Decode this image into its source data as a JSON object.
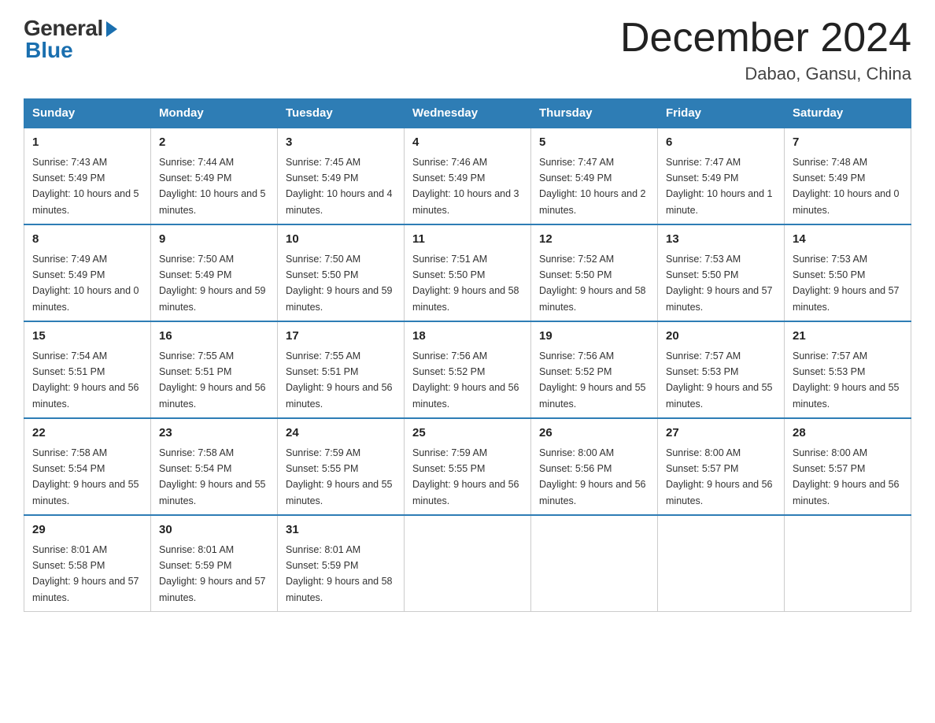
{
  "logo": {
    "general": "General",
    "blue": "Blue"
  },
  "title": "December 2024",
  "location": "Dabao, Gansu, China",
  "days_of_week": [
    "Sunday",
    "Monday",
    "Tuesday",
    "Wednesday",
    "Thursday",
    "Friday",
    "Saturday"
  ],
  "weeks": [
    [
      {
        "day": "1",
        "sunrise": "7:43 AM",
        "sunset": "5:49 PM",
        "daylight": "10 hours and 5 minutes."
      },
      {
        "day": "2",
        "sunrise": "7:44 AM",
        "sunset": "5:49 PM",
        "daylight": "10 hours and 5 minutes."
      },
      {
        "day": "3",
        "sunrise": "7:45 AM",
        "sunset": "5:49 PM",
        "daylight": "10 hours and 4 minutes."
      },
      {
        "day": "4",
        "sunrise": "7:46 AM",
        "sunset": "5:49 PM",
        "daylight": "10 hours and 3 minutes."
      },
      {
        "day": "5",
        "sunrise": "7:47 AM",
        "sunset": "5:49 PM",
        "daylight": "10 hours and 2 minutes."
      },
      {
        "day": "6",
        "sunrise": "7:47 AM",
        "sunset": "5:49 PM",
        "daylight": "10 hours and 1 minute."
      },
      {
        "day": "7",
        "sunrise": "7:48 AM",
        "sunset": "5:49 PM",
        "daylight": "10 hours and 0 minutes."
      }
    ],
    [
      {
        "day": "8",
        "sunrise": "7:49 AM",
        "sunset": "5:49 PM",
        "daylight": "10 hours and 0 minutes."
      },
      {
        "day": "9",
        "sunrise": "7:50 AM",
        "sunset": "5:49 PM",
        "daylight": "9 hours and 59 minutes."
      },
      {
        "day": "10",
        "sunrise": "7:50 AM",
        "sunset": "5:50 PM",
        "daylight": "9 hours and 59 minutes."
      },
      {
        "day": "11",
        "sunrise": "7:51 AM",
        "sunset": "5:50 PM",
        "daylight": "9 hours and 58 minutes."
      },
      {
        "day": "12",
        "sunrise": "7:52 AM",
        "sunset": "5:50 PM",
        "daylight": "9 hours and 58 minutes."
      },
      {
        "day": "13",
        "sunrise": "7:53 AM",
        "sunset": "5:50 PM",
        "daylight": "9 hours and 57 minutes."
      },
      {
        "day": "14",
        "sunrise": "7:53 AM",
        "sunset": "5:50 PM",
        "daylight": "9 hours and 57 minutes."
      }
    ],
    [
      {
        "day": "15",
        "sunrise": "7:54 AM",
        "sunset": "5:51 PM",
        "daylight": "9 hours and 56 minutes."
      },
      {
        "day": "16",
        "sunrise": "7:55 AM",
        "sunset": "5:51 PM",
        "daylight": "9 hours and 56 minutes."
      },
      {
        "day": "17",
        "sunrise": "7:55 AM",
        "sunset": "5:51 PM",
        "daylight": "9 hours and 56 minutes."
      },
      {
        "day": "18",
        "sunrise": "7:56 AM",
        "sunset": "5:52 PM",
        "daylight": "9 hours and 56 minutes."
      },
      {
        "day": "19",
        "sunrise": "7:56 AM",
        "sunset": "5:52 PM",
        "daylight": "9 hours and 55 minutes."
      },
      {
        "day": "20",
        "sunrise": "7:57 AM",
        "sunset": "5:53 PM",
        "daylight": "9 hours and 55 minutes."
      },
      {
        "day": "21",
        "sunrise": "7:57 AM",
        "sunset": "5:53 PM",
        "daylight": "9 hours and 55 minutes."
      }
    ],
    [
      {
        "day": "22",
        "sunrise": "7:58 AM",
        "sunset": "5:54 PM",
        "daylight": "9 hours and 55 minutes."
      },
      {
        "day": "23",
        "sunrise": "7:58 AM",
        "sunset": "5:54 PM",
        "daylight": "9 hours and 55 minutes."
      },
      {
        "day": "24",
        "sunrise": "7:59 AM",
        "sunset": "5:55 PM",
        "daylight": "9 hours and 55 minutes."
      },
      {
        "day": "25",
        "sunrise": "7:59 AM",
        "sunset": "5:55 PM",
        "daylight": "9 hours and 56 minutes."
      },
      {
        "day": "26",
        "sunrise": "8:00 AM",
        "sunset": "5:56 PM",
        "daylight": "9 hours and 56 minutes."
      },
      {
        "day": "27",
        "sunrise": "8:00 AM",
        "sunset": "5:57 PM",
        "daylight": "9 hours and 56 minutes."
      },
      {
        "day": "28",
        "sunrise": "8:00 AM",
        "sunset": "5:57 PM",
        "daylight": "9 hours and 56 minutes."
      }
    ],
    [
      {
        "day": "29",
        "sunrise": "8:01 AM",
        "sunset": "5:58 PM",
        "daylight": "9 hours and 57 minutes."
      },
      {
        "day": "30",
        "sunrise": "8:01 AM",
        "sunset": "5:59 PM",
        "daylight": "9 hours and 57 minutes."
      },
      {
        "day": "31",
        "sunrise": "8:01 AM",
        "sunset": "5:59 PM",
        "daylight": "9 hours and 58 minutes."
      },
      null,
      null,
      null,
      null
    ]
  ],
  "labels": {
    "sunrise": "Sunrise:",
    "sunset": "Sunset:",
    "daylight": "Daylight:"
  }
}
